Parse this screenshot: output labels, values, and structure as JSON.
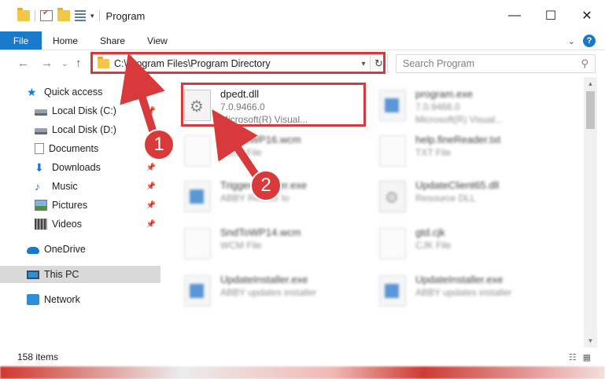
{
  "window": {
    "title": "Program",
    "controls": {
      "minimize": "—",
      "maximize": "☐",
      "close": "✕"
    }
  },
  "ribbon": {
    "tabs": [
      "File",
      "Home",
      "Share",
      "View"
    ]
  },
  "address": {
    "path": "C:\\Program Files\\Program Directory"
  },
  "search": {
    "placeholder": "Search Program"
  },
  "nav": {
    "items": [
      {
        "label": "Quick access",
        "icon": "star-icon"
      },
      {
        "label": "Local Disk (C:)",
        "icon": "disk-icon"
      },
      {
        "label": "Local Disk (D:)",
        "icon": "disk-icon"
      },
      {
        "label": "Documents",
        "icon": "documents-icon"
      },
      {
        "label": "Downloads",
        "icon": "downloads-icon"
      },
      {
        "label": "Music",
        "icon": "music-icon"
      },
      {
        "label": "Pictures",
        "icon": "pictures-icon"
      },
      {
        "label": "Videos",
        "icon": "videos-icon"
      },
      {
        "label": "OneDrive",
        "icon": "onedrive-icon"
      },
      {
        "label": "This PC",
        "icon": "this-pc-icon"
      },
      {
        "label": "Network",
        "icon": "network-icon"
      }
    ]
  },
  "files": [
    {
      "name": "dpedt.dll",
      "line1": "7.0.9466.0",
      "line2": "Microsoft(R) Visual...",
      "kind": "dll"
    },
    {
      "name": "program.exe",
      "line1": "7.0.9466.0",
      "line2": "Microsoft(R) Visual...",
      "kind": "exe"
    },
    {
      "name": "SndToWP16.wcm",
      "line1": "WCM File",
      "line2": "",
      "kind": "doc"
    },
    {
      "name": "help.fineReader.txt",
      "line1": "TXT File",
      "line2": "",
      "kind": "doc"
    },
    {
      "name": "TriggerInstaller.exe",
      "line1": "ABBY Reader to",
      "line2": "",
      "kind": "exe"
    },
    {
      "name": "UpdateClient65.dll",
      "line1": "Resource DLL",
      "line2": "",
      "kind": "dll"
    },
    {
      "name": "SndToWP14.wcm",
      "line1": "WCM File",
      "line2": "",
      "kind": "doc"
    },
    {
      "name": "gtd.cjk",
      "line1": "CJK File",
      "line2": "",
      "kind": "doc"
    },
    {
      "name": "UpdateInstaller.exe",
      "line1": "ABBY updates installer",
      "line2": "",
      "kind": "exe"
    },
    {
      "name": "UpdateInstaller.exe",
      "line1": "ABBY updates installer",
      "line2": "",
      "kind": "exe"
    }
  ],
  "status": {
    "items_count": "158 items"
  },
  "annotations": {
    "callout1": "1",
    "callout2": "2",
    "color": "#d8393a"
  },
  "colors": {
    "accent": "#1979ca",
    "highlight": "#d8393a"
  }
}
